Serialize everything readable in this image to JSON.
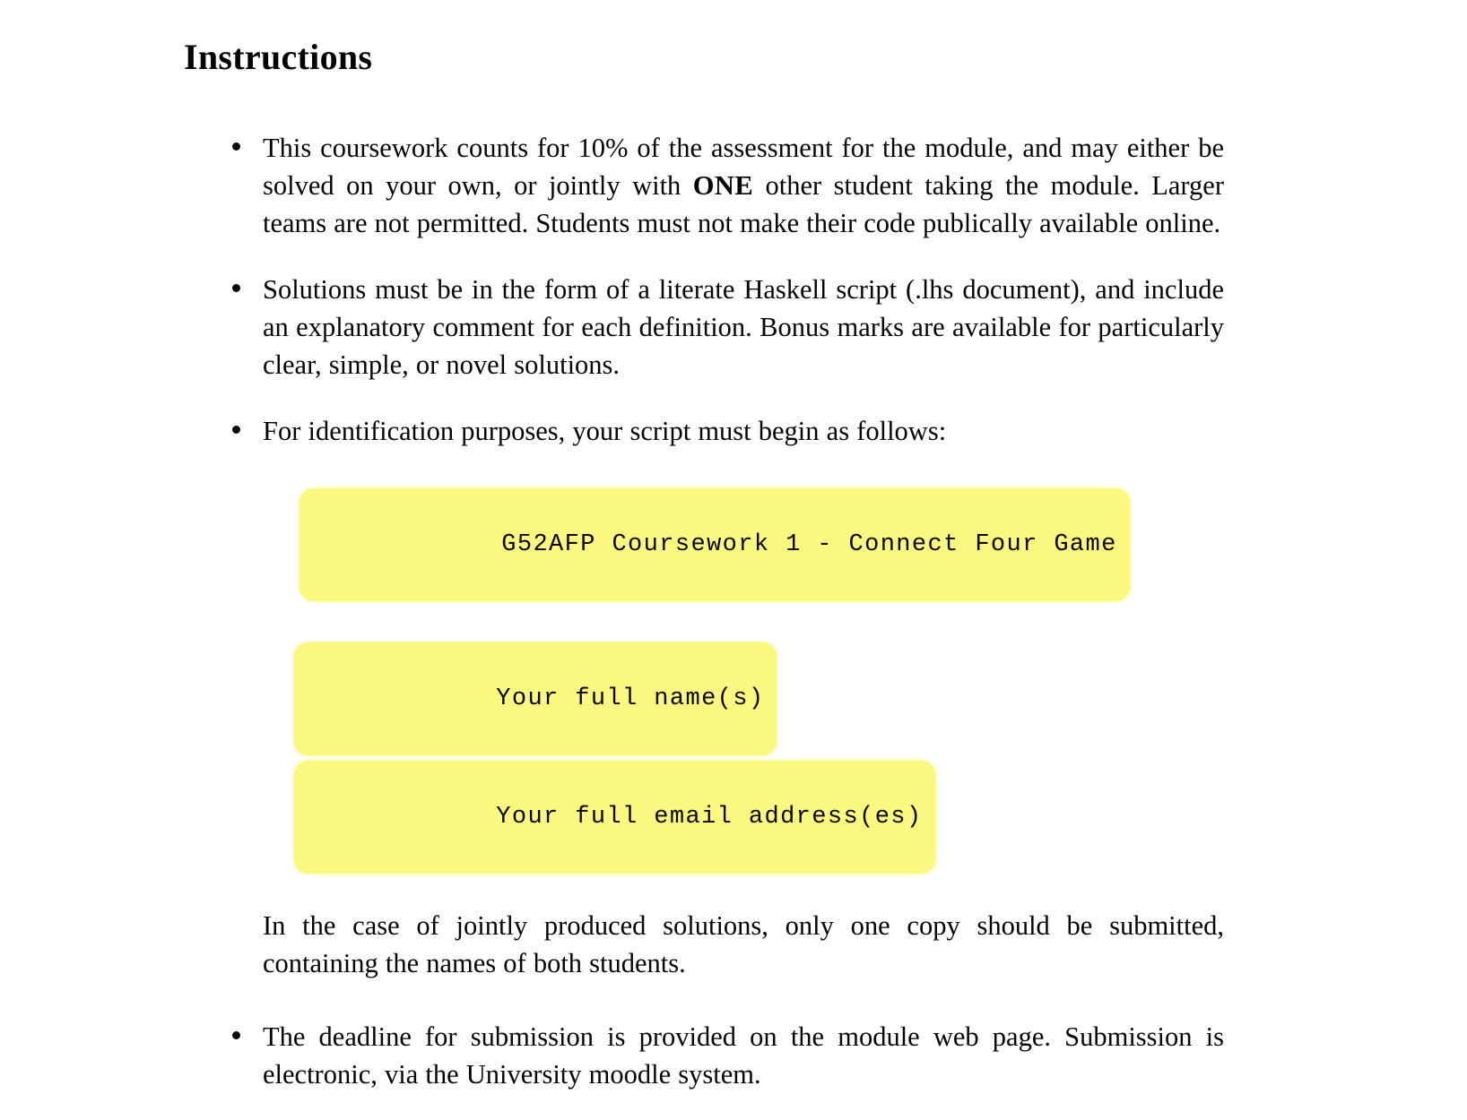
{
  "document": {
    "heading": "Instructions",
    "bullets": [
      {
        "id": "coursework-weighting",
        "text_before_bold": "This coursework counts for 10% of the assessment for the module, and may either be solved on your own, or jointly with ",
        "bold": "ONE",
        "text_after_bold": " other student taking the module. Larger teams are not permitted. Students must not make their code publically available online."
      },
      {
        "id": "solution-format",
        "text": "Solutions must be in the form of a literate Haskell script (.lhs document), and include an explanatory comment for each definition. Bonus marks are available for particularly clear, simple, or novel solutions."
      },
      {
        "id": "identification",
        "text": "For identification purposes, your script must begin as follows:"
      },
      {
        "id": "deadline",
        "text": "The deadline for submission is provided on the module web page. Submission is electronic, via the University moodle system."
      }
    ],
    "code_lines": [
      {
        "id": "header-line",
        "text": "G52AFP Coursework 1 - Connect Four Game",
        "highlight": "#faf87e"
      },
      {
        "id": "name-line",
        "text": "Your full name(s)",
        "highlight": "#faf87e"
      },
      {
        "id": "email-line",
        "text": "Your full email address(es)",
        "highlight": "#faf87e"
      }
    ],
    "joint_note": "In the case of jointly produced solutions, only one copy should be submitted, containing the names of both students."
  },
  "colors": {
    "highlight_yellow": "#faf87e",
    "text_black": "#050505",
    "page_background": "#ffffff"
  }
}
